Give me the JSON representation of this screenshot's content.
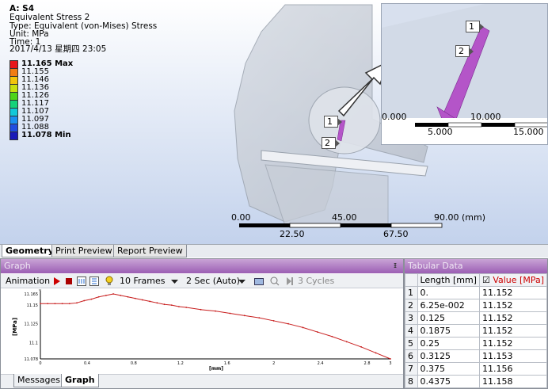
{
  "result": {
    "title": "A: S4",
    "lines": [
      "Equivalent Stress 2",
      "Type: Equivalent (von-Mises) Stress",
      "Unit: MPa",
      "Time: 1",
      "2017/4/13 星期四 23:05"
    ],
    "legend": [
      {
        "label": "11.165 Max",
        "color": "#e8171b",
        "bold": true
      },
      {
        "label": "11.155",
        "color": "#f07c14"
      },
      {
        "label": "11.146",
        "color": "#f2c40c"
      },
      {
        "label": "11.136",
        "color": "#c8e010"
      },
      {
        "label": "11.126",
        "color": "#4fd41a"
      },
      {
        "label": "11.117",
        "color": "#16d27a"
      },
      {
        "label": "11.107",
        "color": "#12c8d8"
      },
      {
        "label": "11.097",
        "color": "#1a8ff0"
      },
      {
        "label": "11.088",
        "color": "#1f4de0"
      },
      {
        "label": "11.078 Min",
        "color": "#1a1ab8",
        "bold": true
      }
    ]
  },
  "probes": {
    "label_1": "1",
    "label_2": "2"
  },
  "scale_main": {
    "top_left": "0.00",
    "top_mid": "45.00",
    "top_right": "90.00 (mm)",
    "bottom_left": "22.50",
    "bottom_right": "67.50"
  },
  "scale_inset": {
    "top_left": "0.000",
    "top_right": "10.000",
    "bottom_left": "5.000",
    "bottom_right": "15.000"
  },
  "tabs": [
    "Geometry",
    "Print Preview",
    "Report Preview"
  ],
  "graph": {
    "panel_title": "Graph",
    "pin": "ᵻ",
    "animation_label": "Animation",
    "frames": "10 Frames",
    "duration": "2 Sec (Auto)",
    "cycles": "3 Cycles",
    "bottom_tabs": [
      "Messages",
      "Graph"
    ]
  },
  "chart_data": {
    "type": "line",
    "ylabel": "[MPa]",
    "xlabel": "[mm]",
    "y_top_label": "0",
    "yticks": [
      "11.165",
      "11.15",
      "11.125",
      "11.1",
      "11.078"
    ],
    "xticks": [
      "0",
      "0.4",
      "0.8",
      "1.2",
      "1.6",
      "2",
      "2.4",
      "2.8",
      "3"
    ],
    "xlim": [
      0,
      3
    ],
    "ylim": [
      11.078,
      11.165
    ],
    "series": [
      {
        "color": "#c81e1e",
        "x": [
          0,
          0.0625,
          0.125,
          0.1875,
          0.25,
          0.3125,
          0.375,
          0.4375,
          0.5,
          0.5625,
          0.625,
          0.6875,
          0.75,
          0.8125,
          0.875,
          0.9375,
          1.0,
          1.0625,
          1.125,
          1.1875,
          1.25,
          1.375,
          1.5,
          1.625,
          1.75,
          1.875,
          2.0,
          2.125,
          2.25,
          2.375,
          2.5,
          2.625,
          2.75,
          2.875,
          3.0
        ],
        "y": [
          11.152,
          11.152,
          11.152,
          11.152,
          11.152,
          11.153,
          11.156,
          11.158,
          11.161,
          11.163,
          11.165,
          11.163,
          11.161,
          11.159,
          11.157,
          11.155,
          11.153,
          11.151,
          11.15,
          11.148,
          11.147,
          11.144,
          11.142,
          11.139,
          11.136,
          11.133,
          11.129,
          11.125,
          11.12,
          11.114,
          11.108,
          11.101,
          11.094,
          11.086,
          11.078
        ]
      }
    ]
  },
  "table": {
    "panel_title": "Tabular Data",
    "headers": [
      "",
      "Length [mm]",
      "Value [MPa]"
    ],
    "checkbox": "☑",
    "rows": [
      [
        "1",
        "0.",
        "11.152"
      ],
      [
        "2",
        "6.25e-002",
        "11.152"
      ],
      [
        "3",
        "0.125",
        "11.152"
      ],
      [
        "4",
        "0.1875",
        "11.152"
      ],
      [
        "5",
        "0.25",
        "11.152"
      ],
      [
        "6",
        "0.3125",
        "11.153"
      ],
      [
        "7",
        "0.375",
        "11.156"
      ],
      [
        "8",
        "0.4375",
        "11.158"
      ]
    ]
  }
}
